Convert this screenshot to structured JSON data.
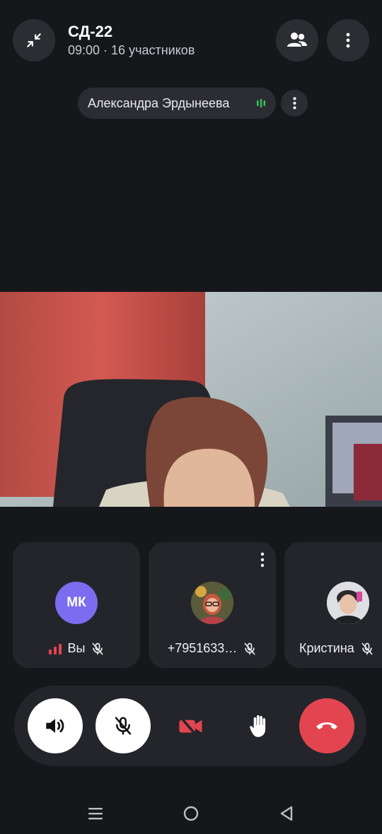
{
  "header": {
    "title": "СД-22",
    "subtitle": "09:00 · 16 участников",
    "minimize_icon": "minimize-icon",
    "participants_icon": "participants-icon",
    "more_icon": "more-vertical-icon"
  },
  "active_speaker": {
    "name": "Александра Эрдынеева",
    "speaking_indicator_color": "#35c759"
  },
  "participants": [
    {
      "name": "Вы",
      "initials": "МК",
      "avatar_color": "#7c6cf0",
      "muted": true,
      "signal_color": "#e2454f"
    },
    {
      "name": "+7951633…",
      "muted": true
    },
    {
      "name": "Кристина",
      "muted": true
    }
  ],
  "controls": [
    {
      "name": "speaker-button",
      "icon": "speaker-icon"
    },
    {
      "name": "microphone-button",
      "icon": "mic-off-icon"
    },
    {
      "name": "camera-button",
      "icon": "camera-off-icon",
      "color": "#e2454f"
    },
    {
      "name": "raise-hand-button",
      "icon": "hand-icon"
    },
    {
      "name": "end-call-button",
      "icon": "phone-hangup-icon",
      "color": "#e2454f"
    }
  ],
  "colors": {
    "background": "#16171b",
    "surface": "#24252b",
    "danger": "#e2454f"
  }
}
